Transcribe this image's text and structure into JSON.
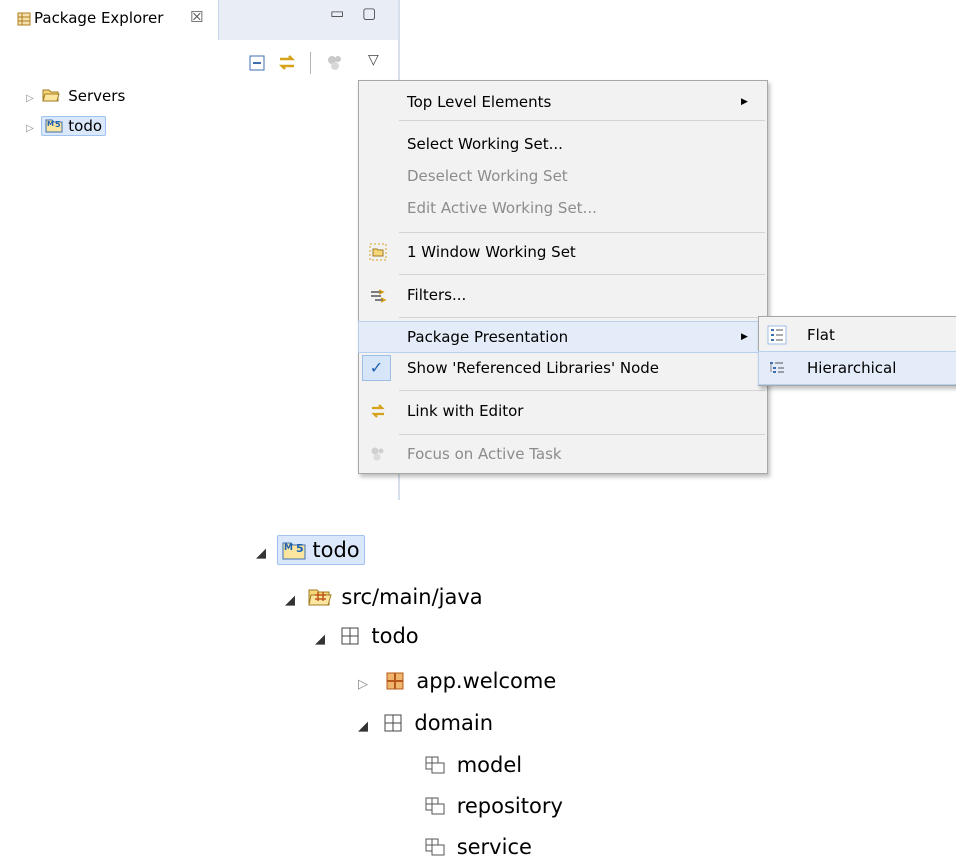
{
  "view": {
    "title": "Package Explorer",
    "close_symbol": "☒",
    "minimize_symbol": "▭",
    "maximize_symbol": "▢",
    "view_menu_symbol": "▽"
  },
  "tree_small": [
    {
      "label": "Servers",
      "icon": "folder-icon",
      "expander": "▷",
      "selected": false
    },
    {
      "label": "todo",
      "icon": "maven-project-icon",
      "expander": "▷",
      "selected": true
    }
  ],
  "menu": {
    "items": [
      {
        "label": "Top Level Elements",
        "has_submenu": true
      },
      {
        "label": "Select Working Set..."
      },
      {
        "label": "Deselect Working Set",
        "disabled": true
      },
      {
        "label": "Edit Active Working Set...",
        "disabled": true
      },
      {
        "label": "1 Window Working Set",
        "icon": "working-set-icon"
      },
      {
        "label": "Filters...",
        "icon": "filter-icon"
      },
      {
        "label": "Package Presentation",
        "has_submenu": true,
        "highlighted": true
      },
      {
        "label": "Show 'Referenced Libraries' Node",
        "checked": true,
        "check_symbol": "✓"
      },
      {
        "label": "Link with Editor",
        "icon": "link-editor-icon"
      },
      {
        "label": "Focus on Active Task",
        "icon": "focus-task-icon",
        "disabled": true
      }
    ],
    "arrow_symbol": "▶"
  },
  "submenu": {
    "items": [
      {
        "label": "Flat",
        "icon": "flat-layout-icon"
      },
      {
        "label": "Hierarchical",
        "icon": "hierarchical-layout-icon",
        "highlighted": true
      }
    ]
  },
  "tree_large": [
    {
      "label": "todo",
      "expander": "◢",
      "icon": "maven-project-icon",
      "selected": true
    },
    {
      "label": "src/main/java",
      "expander": "◢",
      "icon": "source-folder-icon"
    },
    {
      "label": "todo",
      "expander": "◢",
      "icon": "package-icon"
    },
    {
      "label": "app.welcome",
      "expander": "▷",
      "icon": "package-colored-icon"
    },
    {
      "label": "domain",
      "expander": "◢",
      "icon": "package-icon"
    },
    {
      "label": "model",
      "icon": "empty-package-icon"
    },
    {
      "label": "repository",
      "icon": "empty-package-icon"
    },
    {
      "label": "service",
      "icon": "empty-package-icon"
    }
  ],
  "colors": {
    "selection": "#dbe8fb",
    "menu_bg": "#f2f2f2",
    "accent": "#1a5fb4"
  }
}
